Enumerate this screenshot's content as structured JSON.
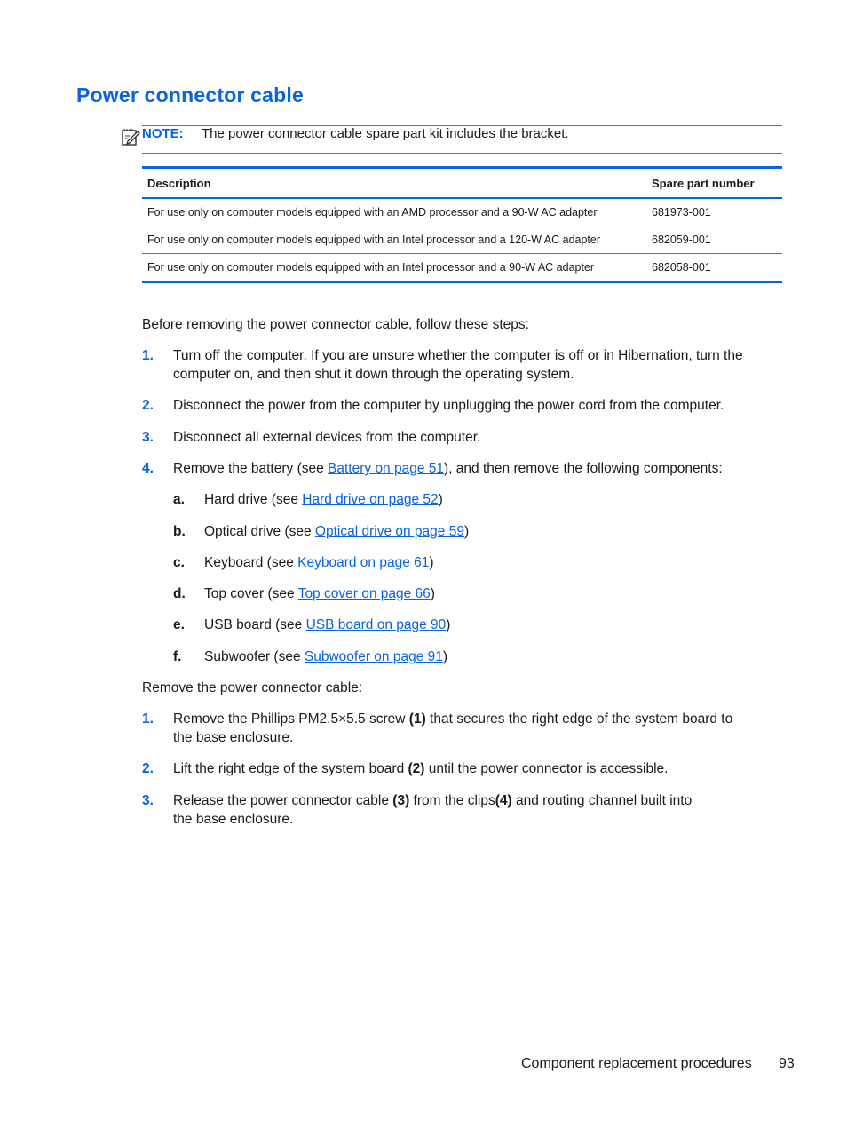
{
  "heading": "Power connector cable",
  "note": {
    "icon": "note-pencil-icon",
    "label": "NOTE:",
    "text": "The power connector cable spare part kit includes the bracket."
  },
  "table": {
    "headers": [
      "Description",
      "Spare part number"
    ],
    "rows": [
      [
        "For use only on computer models equipped with an AMD processor and a 90-W AC adapter",
        "681973-001"
      ],
      [
        "For use only on computer models equipped with an Intel processor and a 120-W AC adapter",
        "682059-001"
      ],
      [
        "For use only on computer models equipped with an Intel processor and a 90-W AC adapter",
        "682058-001"
      ]
    ]
  },
  "intro": "Before removing the power connector cable, follow these steps:",
  "prep_steps": [
    {
      "num": "1.",
      "text": "Turn off the computer. If you are unsure whether the computer is off or in Hibernation, turn the computer on, and then shut it down through the operating system."
    },
    {
      "num": "2.",
      "text": "Disconnect the power from the computer by unplugging the power cord from the computer."
    },
    {
      "num": "3.",
      "text": "Disconnect all external devices from the computer."
    },
    {
      "num": "4.",
      "before": "Remove the battery (see ",
      "link": "Battery on page 51",
      "after": "), and then remove the following components:"
    }
  ],
  "sub_steps": [
    {
      "num": "a.",
      "before": "Hard drive (see ",
      "link": "Hard drive on page 52",
      "after": ")"
    },
    {
      "num": "b.",
      "before": "Optical drive (see ",
      "link": "Optical drive on page 59",
      "after": ")"
    },
    {
      "num": "c.",
      "before": "Keyboard (see ",
      "link": "Keyboard on page 61",
      "after": ")"
    },
    {
      "num": "d.",
      "before": "Top cover (see ",
      "link": "Top cover on page 66",
      "after": ")"
    },
    {
      "num": "e.",
      "before": "USB board (see ",
      "link": "USB board on page 90",
      "after": ")"
    },
    {
      "num": "f.",
      "before": "Subwoofer (see ",
      "link": "Subwoofer on page 91",
      "after": ")"
    }
  ],
  "remove_intro": "Remove the power connector cable:",
  "remove_steps": [
    {
      "num": "1.",
      "t1": "Remove the Phillips PM2.5×5.5 screw ",
      "b1": "(1)",
      "t2": " that secures the right edge of the system board to the base enclosure."
    },
    {
      "num": "2.",
      "t1": "Lift the right edge of the system board ",
      "b1": "(2)",
      "t2": " until the power connector is accessible."
    },
    {
      "num": "3.",
      "t1": "Release the power connector cable ",
      "b1": "(3)",
      "t2": " from the clips",
      "b2": "(4)",
      "t3": " and routing channel built into the base enclosure."
    }
  ],
  "footer": {
    "section": "Component replacement procedures",
    "page": "93"
  }
}
